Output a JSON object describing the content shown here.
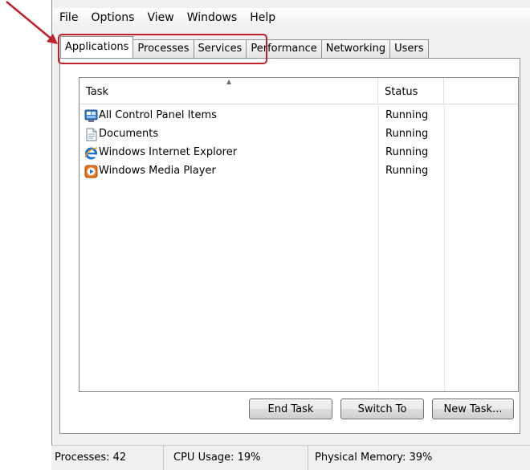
{
  "menu": [
    "File",
    "Options",
    "View",
    "Windows",
    "Help"
  ],
  "tabs": [
    {
      "label": "Applications",
      "active": true
    },
    {
      "label": "Processes",
      "active": false
    },
    {
      "label": "Services",
      "active": false
    },
    {
      "label": "Performance",
      "active": false
    },
    {
      "label": "Networking",
      "active": false
    },
    {
      "label": "Users",
      "active": false
    }
  ],
  "list": {
    "columns": {
      "task": "Task",
      "status": "Status"
    },
    "rows": [
      {
        "task": "All Control Panel Items",
        "status": "Running",
        "icon": "control-panel-icon"
      },
      {
        "task": "Documents",
        "status": "Running",
        "icon": "document-icon"
      },
      {
        "task": "Windows Internet Explorer",
        "status": "Running",
        "icon": "internet-explorer-icon"
      },
      {
        "task": "Windows Media Player",
        "status": "Running",
        "icon": "media-player-icon"
      }
    ]
  },
  "buttons": {
    "end_task": "End Task",
    "switch_to": "Switch To",
    "new_task": "New Task..."
  },
  "statusbar": {
    "processes": "Processes: 42",
    "cpu": "CPU Usage: 19%",
    "memory": "Physical Memory: 39%"
  },
  "annotation": {
    "highlight_color": "#c0202a"
  }
}
